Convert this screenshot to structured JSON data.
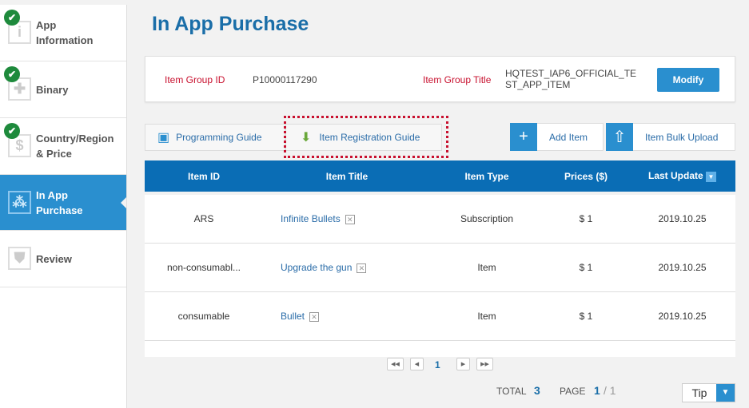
{
  "sidebar": {
    "items": [
      {
        "label": "App Information",
        "done": true
      },
      {
        "label": "Binary",
        "done": true
      },
      {
        "label": "Country/Region & Price",
        "done": true
      },
      {
        "label": "In App Purchase",
        "done": false,
        "active": true
      },
      {
        "label": "Review",
        "done": false
      }
    ]
  },
  "page_title": "In App Purchase",
  "group": {
    "id_label": "Item Group ID",
    "id_value": "P10000117290",
    "title_label": "Item Group Title",
    "title_value": "HQTEST_IAP6_OFFICIAL_TEST_APP_ITEM",
    "modify": "Modify"
  },
  "tabs": {
    "programming": "Programming Guide",
    "registration": "Item Registration Guide"
  },
  "actions": {
    "add": "Add Item",
    "bulk": "Item Bulk Upload"
  },
  "table": {
    "headers": [
      "Item ID",
      "Item Title",
      "Item Type",
      "Prices ($)",
      "Last Update"
    ],
    "rows": [
      [
        "ARS",
        "Infinite Bullets",
        "Subscription",
        "$ 1",
        "2019.10.25"
      ],
      [
        "non-consumabl...",
        "Upgrade the gun",
        "Item",
        "$ 1",
        "2019.10.25"
      ],
      [
        "consumable",
        "Bullet",
        "Item",
        "$ 1",
        "2019.10.25"
      ]
    ]
  },
  "pagination": {
    "current": "1",
    "total_label": "TOTAL",
    "total": "3",
    "page_label": "PAGE",
    "page": "1",
    "pages": "/ 1"
  },
  "tip": "Tip"
}
